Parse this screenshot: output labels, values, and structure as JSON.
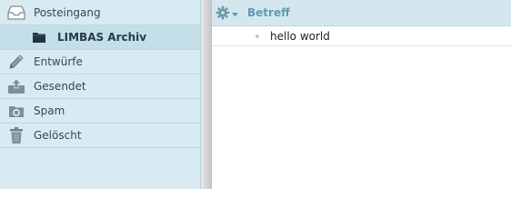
{
  "sidebar": {
    "folders": [
      {
        "label": "Posteingang",
        "icon": "inbox-icon"
      },
      {
        "label": "LIMBAS Archiv",
        "icon": "folder-icon"
      },
      {
        "label": "Entwürfe",
        "icon": "pencil-icon"
      },
      {
        "label": "Gesendet",
        "icon": "sent-icon"
      },
      {
        "label": "Spam",
        "icon": "spam-icon"
      },
      {
        "label": "Gelöscht",
        "icon": "trash-icon"
      }
    ]
  },
  "list": {
    "settings_icon": "gear-icon",
    "subject_header": "Betreff",
    "messages": [
      {
        "subject": "hello world"
      }
    ]
  },
  "colors": {
    "sidebar_bg": "#d9ebf2",
    "selected_bg": "#c5dfe9",
    "header_bg": "#d4e7ef",
    "header_text": "#5f9bb3"
  }
}
